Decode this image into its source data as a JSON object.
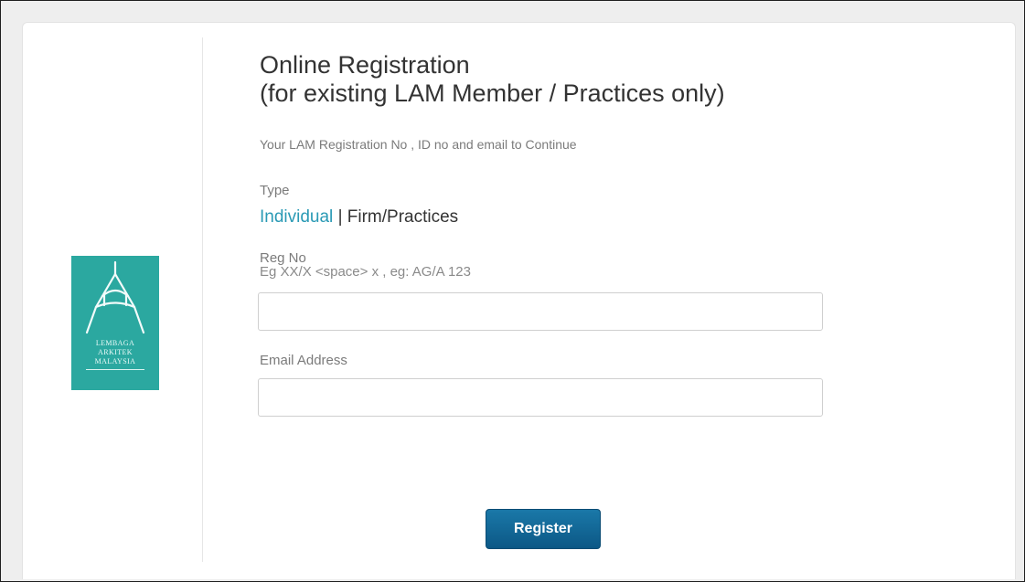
{
  "logo": {
    "lines": [
      "LEMBAGA",
      "ARKITEK",
      "MALAYSIA"
    ],
    "color": "#2ba8a0"
  },
  "form": {
    "title_line1": "Online Registration",
    "title_line2": "(for existing LAM Member / Practices only)",
    "subtitle": "Your LAM Registration No , ID no and email to Continue",
    "type_label": "Type",
    "type_options": {
      "selected": "Individual",
      "separator": "|",
      "other": "Firm/Practices"
    },
    "reg_no_label": "Reg No",
    "reg_no_hint": "Eg XX/X <space> x , eg: AG/A 123",
    "reg_no_value": "",
    "email_label": "Email Address",
    "email_value": "",
    "register_label": "Register"
  },
  "colors": {
    "accent_link": "#2a9ab5",
    "button": "#0c5886"
  }
}
